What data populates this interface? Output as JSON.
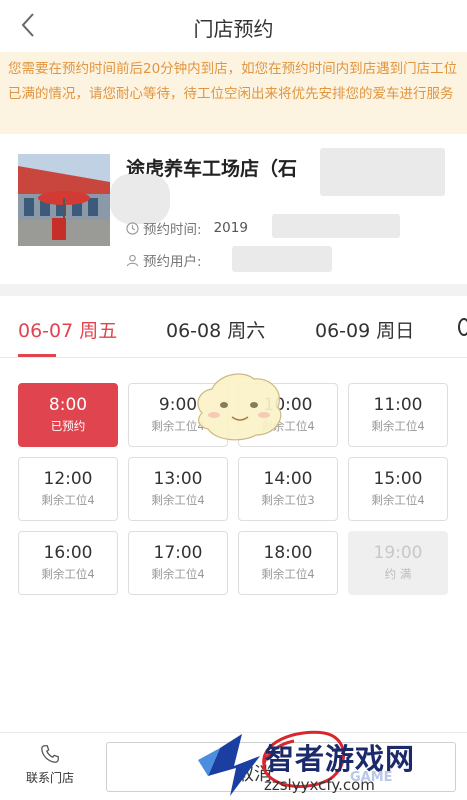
{
  "header": {
    "title": "门店预约"
  },
  "notice": {
    "text": "您需要在预约时间前后20分钟内到店，如您在预约时间内到店遇到门店工位已满的情况，请您耐心等待，待工位空闲出来将优先安排您的爱车进行服务"
  },
  "store": {
    "name": "途虎养车工场店（石",
    "time_label": "预约时间:",
    "time_value": "2019",
    "user_label": "预约用户:"
  },
  "tabs": [
    {
      "label": "06-07 周五",
      "active": true
    },
    {
      "label": "06-08 周六",
      "active": false
    },
    {
      "label": "06-09 周日",
      "active": false
    }
  ],
  "slots": [
    {
      "time": "8:00",
      "status": "已预约",
      "state": "booked"
    },
    {
      "time": "9:00",
      "status": "剩余工位4",
      "state": "available"
    },
    {
      "time": "10:00",
      "status": "剩余工位4",
      "state": "available"
    },
    {
      "time": "11:00",
      "status": "剩余工位4",
      "state": "available"
    },
    {
      "time": "12:00",
      "status": "剩余工位4",
      "state": "available"
    },
    {
      "time": "13:00",
      "status": "剩余工位4",
      "state": "available"
    },
    {
      "time": "14:00",
      "status": "剩余工位3",
      "state": "available"
    },
    {
      "time": "15:00",
      "status": "剩余工位4",
      "state": "available"
    },
    {
      "time": "16:00",
      "status": "剩余工位4",
      "state": "available"
    },
    {
      "time": "17:00",
      "status": "剩余工位4",
      "state": "available"
    },
    {
      "time": "18:00",
      "status": "剩余工位4",
      "state": "available"
    },
    {
      "time": "19:00",
      "status": "约 满",
      "state": "full"
    }
  ],
  "bottom": {
    "contact_label": "联系门店",
    "contact_icon": "phone-icon",
    "cancel_label": "取消"
  },
  "watermark": {
    "brand": "智者游戏网",
    "url": "zzslyyxcfy.com",
    "game": "GAME"
  },
  "colors": {
    "accent": "#e0454f",
    "notice_bg": "#fdf3e1",
    "notice_text": "#e0963f"
  }
}
